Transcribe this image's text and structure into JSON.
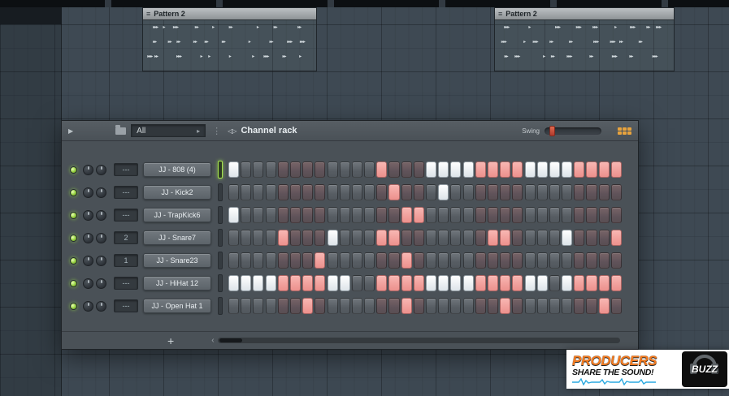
{
  "playlist": {
    "clips": [
      {
        "label": "Pattern 2"
      },
      {
        "label": "Pattern 2"
      }
    ]
  },
  "channel_rack": {
    "title": "Channel rack",
    "library_filter": "All",
    "swing_label": "Swing",
    "add_button_label": "+",
    "steps_per_row": 32,
    "channels": [
      {
        "name": "JJ - 808 (4)",
        "mixer_track": "---",
        "selected": true,
        "steps": [
          0,
          12,
          16,
          17,
          18,
          19,
          20,
          21,
          22,
          23,
          24,
          25,
          26,
          27,
          28,
          29,
          30,
          31
        ]
      },
      {
        "name": "JJ - Kick2",
        "mixer_track": "---",
        "selected": false,
        "steps": [
          13,
          17
        ]
      },
      {
        "name": "JJ - TrapKick6",
        "mixer_track": "---",
        "selected": false,
        "steps": [
          0,
          14,
          15
        ]
      },
      {
        "name": "JJ - Snare7",
        "mixer_track": "2",
        "selected": false,
        "steps": [
          4,
          8,
          12,
          13,
          21,
          22,
          27,
          31
        ]
      },
      {
        "name": "JJ - Snare23",
        "mixer_track": "1",
        "selected": false,
        "steps": [
          7,
          14
        ]
      },
      {
        "name": "JJ - HiHat 12",
        "mixer_track": "---",
        "selected": false,
        "steps": [
          0,
          1,
          2,
          3,
          4,
          5,
          6,
          7,
          8,
          9,
          12,
          13,
          14,
          15,
          16,
          17,
          18,
          19,
          20,
          21,
          22,
          23,
          24,
          25,
          27,
          28,
          29,
          30,
          31
        ]
      },
      {
        "name": "JJ - Open Hat 1",
        "mixer_track": "---",
        "selected": false,
        "steps": [
          6,
          14,
          22,
          30
        ]
      }
    ],
    "colors": {
      "step_lit_red": "#f2a3a0",
      "step_lit_white": "#eef2f4",
      "led_green": "#9fd44a",
      "grid_icon_orange": "#e8a33d",
      "swing_thumb_red": "#c9523f"
    }
  },
  "icons": {
    "play": "▶",
    "combo_arrow": "▸",
    "menu_dots": "⋮",
    "clip_menu": "≡",
    "channel_rack_glyph": "◁▷",
    "scrollbar_left_arrow": "‹"
  },
  "logo": {
    "line1": "PRODUCERS",
    "line2": "SHARE THE SOUND!",
    "badge": "BUZZ"
  }
}
